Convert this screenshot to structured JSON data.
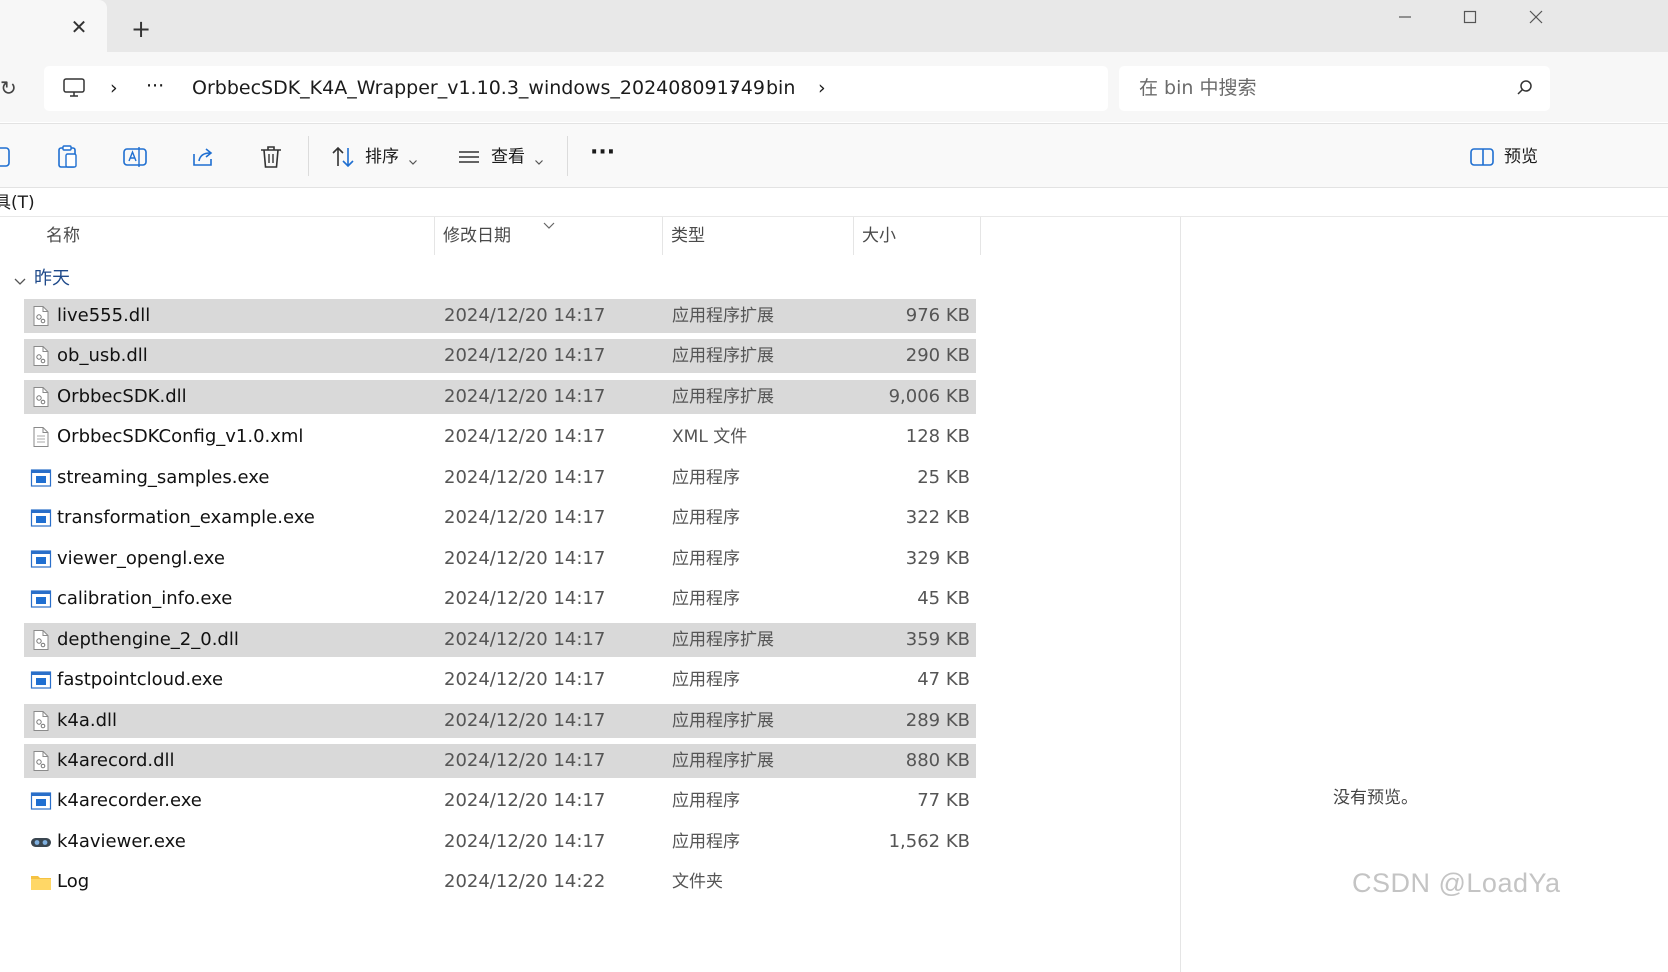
{
  "titlebar": {
    "tab_close_glyph": "✕",
    "new_tab_glyph": "+",
    "minimize_glyph": "—",
    "maximize_glyph": "☐",
    "close_glyph": "✕"
  },
  "address": {
    "refresh_glyph": "↻",
    "ellipsis": "···",
    "crumbs": [
      "OrbbecSDK_K4A_Wrapper_v1.10.3_windows_202408091749",
      "bin"
    ],
    "separator": "›"
  },
  "search": {
    "placeholder": "在 bin 中搜索"
  },
  "toolbar": {
    "sort_label": "排序",
    "view_label": "查看",
    "more_glyph": "···",
    "preview_label": "预览"
  },
  "menu": {
    "tools_label": "具(T)"
  },
  "columns": {
    "name": "名称",
    "date": "修改日期",
    "type": "类型",
    "size": "大小"
  },
  "group": {
    "label": "昨天"
  },
  "files": [
    {
      "name": "live555.dll",
      "date": "2024/12/20 14:17",
      "type": "应用程序扩展",
      "size": "976 KB",
      "icon": "dll-icon",
      "selected": true
    },
    {
      "name": "ob_usb.dll",
      "date": "2024/12/20 14:17",
      "type": "应用程序扩展",
      "size": "290 KB",
      "icon": "dll-icon",
      "selected": true
    },
    {
      "name": "OrbbecSDK.dll",
      "date": "2024/12/20 14:17",
      "type": "应用程序扩展",
      "size": "9,006 KB",
      "icon": "dll-icon",
      "selected": true
    },
    {
      "name": "OrbbecSDKConfig_v1.0.xml",
      "date": "2024/12/20 14:17",
      "type": "XML 文件",
      "size": "128 KB",
      "icon": "xml-file-icon",
      "selected": false
    },
    {
      "name": "streaming_samples.exe",
      "date": "2024/12/20 14:17",
      "type": "应用程序",
      "size": "25 KB",
      "icon": "exe-icon",
      "selected": false
    },
    {
      "name": "transformation_example.exe",
      "date": "2024/12/20 14:17",
      "type": "应用程序",
      "size": "322 KB",
      "icon": "exe-icon",
      "selected": false
    },
    {
      "name": "viewer_opengl.exe",
      "date": "2024/12/20 14:17",
      "type": "应用程序",
      "size": "329 KB",
      "icon": "exe-icon",
      "selected": false
    },
    {
      "name": "calibration_info.exe",
      "date": "2024/12/20 14:17",
      "type": "应用程序",
      "size": "45 KB",
      "icon": "exe-icon",
      "selected": false
    },
    {
      "name": "depthengine_2_0.dll",
      "date": "2024/12/20 14:17",
      "type": "应用程序扩展",
      "size": "359 KB",
      "icon": "dll-icon",
      "selected": true
    },
    {
      "name": "fastpointcloud.exe",
      "date": "2024/12/20 14:17",
      "type": "应用程序",
      "size": "47 KB",
      "icon": "exe-icon",
      "selected": false
    },
    {
      "name": "k4a.dll",
      "date": "2024/12/20 14:17",
      "type": "应用程序扩展",
      "size": "289 KB",
      "icon": "dll-icon",
      "selected": true
    },
    {
      "name": "k4arecord.dll",
      "date": "2024/12/20 14:17",
      "type": "应用程序扩展",
      "size": "880 KB",
      "icon": "dll-icon",
      "selected": true
    },
    {
      "name": "k4arecorder.exe",
      "date": "2024/12/20 14:17",
      "type": "应用程序",
      "size": "77 KB",
      "icon": "exe-icon",
      "selected": false
    },
    {
      "name": "k4aviewer.exe",
      "date": "2024/12/20 14:17",
      "type": "应用程序",
      "size": "1,562 KB",
      "icon": "viewer-app-icon",
      "selected": false
    },
    {
      "name": "Log",
      "date": "2024/12/20 14:22",
      "type": "文件夹",
      "size": "",
      "icon": "folder-icon",
      "selected": false
    }
  ],
  "preview_pane": {
    "empty_text": "没有预览。"
  },
  "watermark": {
    "text": "CSDN @LoadYa"
  },
  "colors": {
    "selection": "#d9d9d9",
    "group_label": "#1f4a8a",
    "exe_blue": "#1f6fd1",
    "folder_yellow": "#f5c242"
  }
}
